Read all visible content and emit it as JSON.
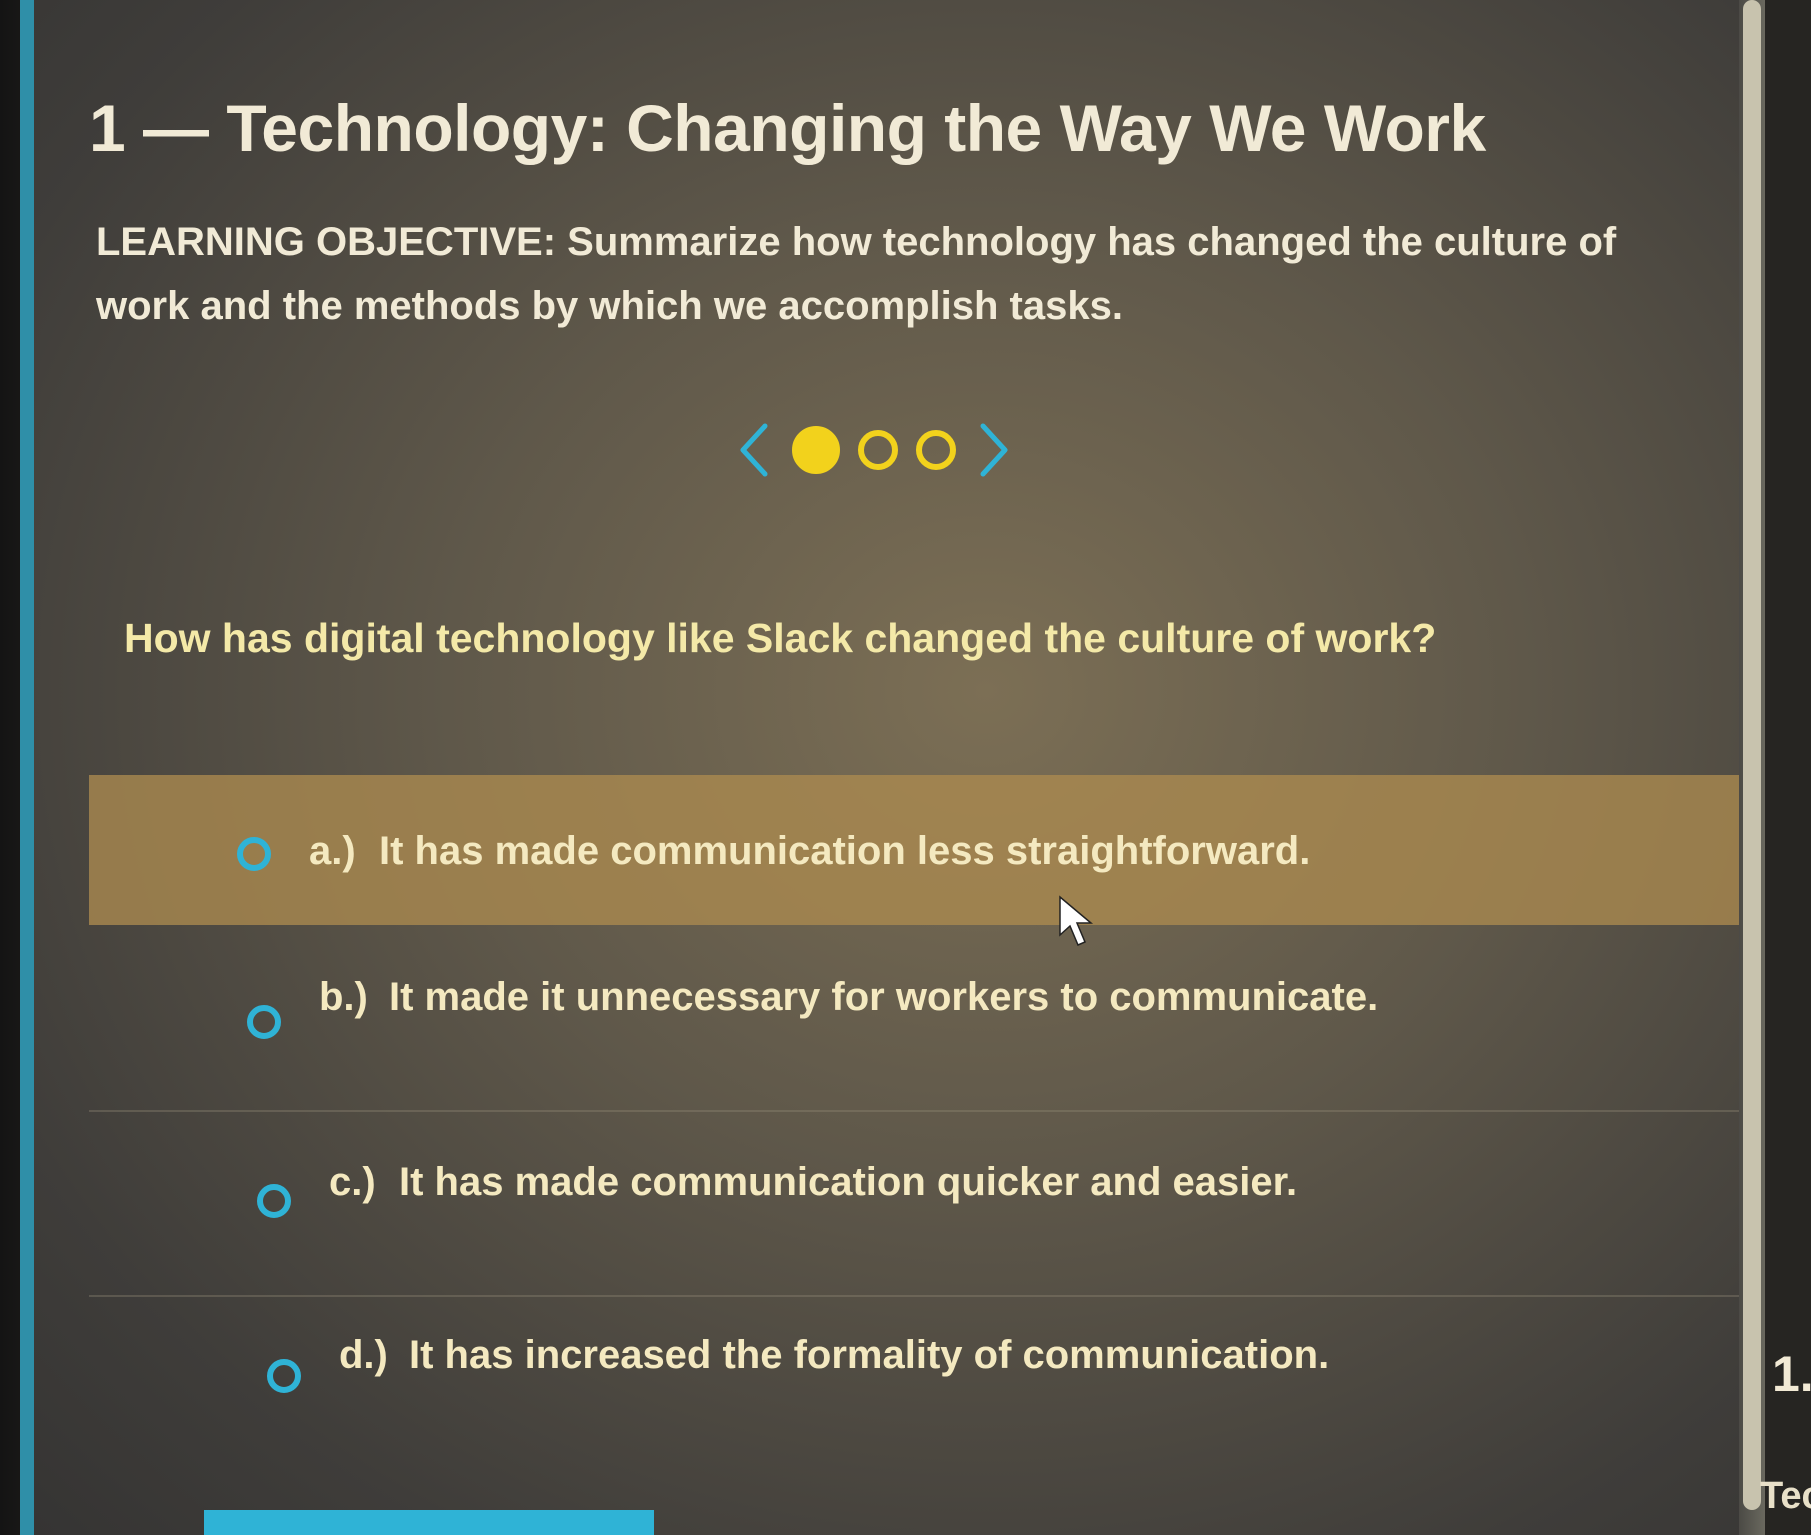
{
  "lesson": {
    "title": "1 — Technology: Changing the Way We Work",
    "objective_label": "LEARNING OBJECTIVE:",
    "objective_text": "Summarize how technology has changed the culture of work and the methods by which we accomplish tasks."
  },
  "pager": {
    "total": 3,
    "current": 1,
    "accent_color": "#f2d21c",
    "arrow_color": "#2fb3d6"
  },
  "question": {
    "prompt": "How has digital technology like Slack changed the culture of work?",
    "options": [
      {
        "letter": "a.)",
        "text": "It has made communication less straightforward."
      },
      {
        "letter": "b.)",
        "text": "It made it unnecessary for workers to communicate."
      },
      {
        "letter": "c.)",
        "text": "It has made communication quicker and easier."
      },
      {
        "letter": "d.)",
        "text": "It has increased the formality of communication."
      }
    ],
    "hovered_option": "a.)"
  },
  "side_panel": {
    "number": "1.",
    "label": "Tec"
  }
}
